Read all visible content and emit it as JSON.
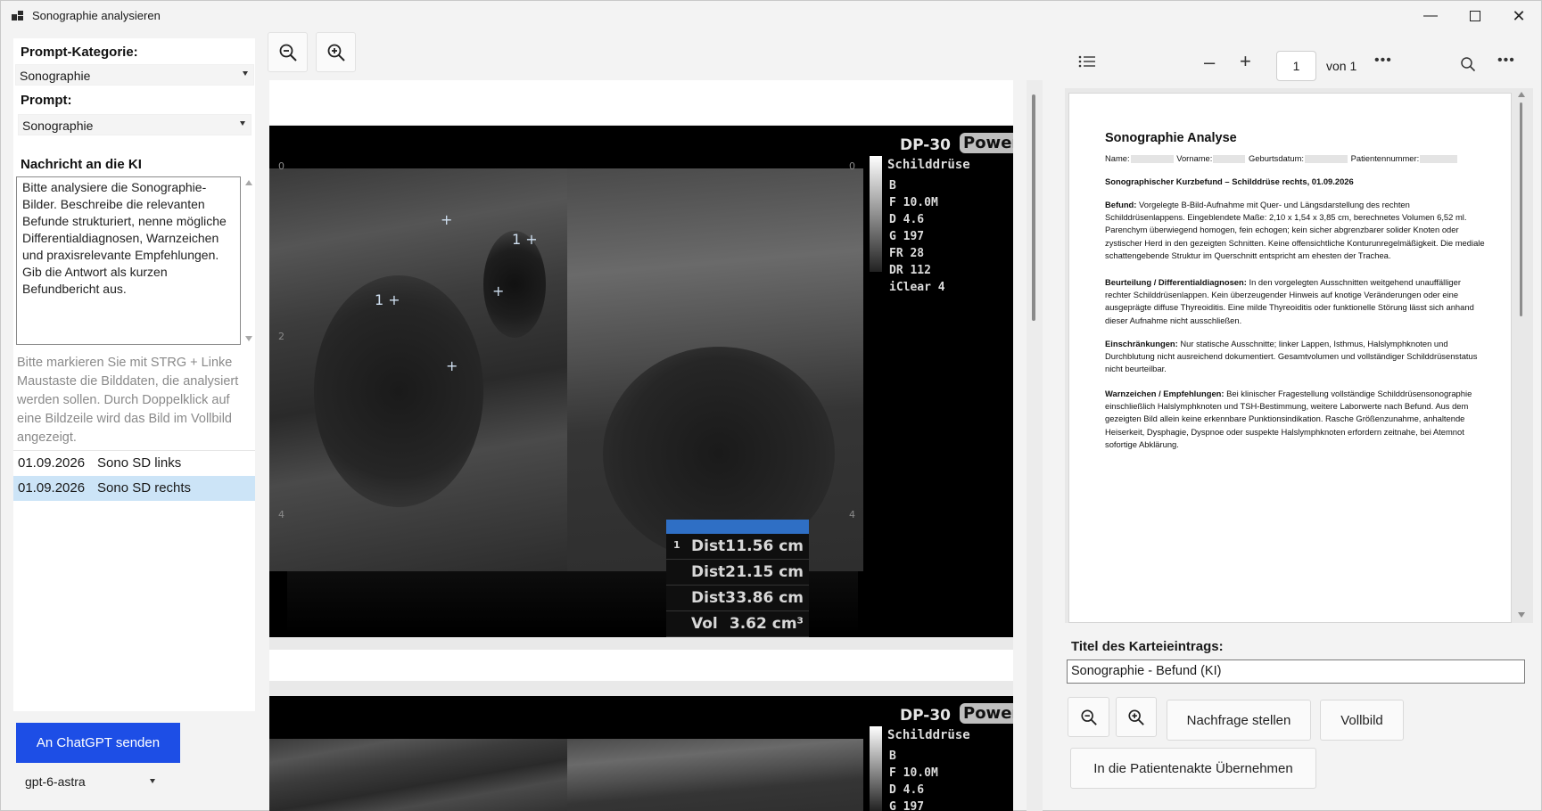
{
  "window": {
    "title": "Sonographie analysieren"
  },
  "left": {
    "prompt_category_label": "Prompt-Kategorie:",
    "prompt_category_value": "Sonographie",
    "prompt_label": "Prompt:",
    "prompt_value": "Sonographie",
    "message_label": "Nachricht an die KI",
    "message_text": "Bitte analysiere die Sonographie-Bilder. Beschreibe die relevanten Befunde strukturiert, nenne mögliche Differentialdiagnosen, Warnzeichen und praxisrelevante Empfehlungen. Gib die Antwort als kurzen Befundbericht aus.",
    "hint": "Bitte markieren Sie mit STRG + Linke Maustaste die Bilddaten, die analysiert werden sollen. Durch Doppelklick auf eine Bildzeile wird das Bild im Vollbild angezeigt.",
    "images": [
      {
        "date": "01.09.2026",
        "name": "Sono SD links",
        "selected": false
      },
      {
        "date": "01.09.2026",
        "name": "Sono SD rechts",
        "selected": true
      }
    ],
    "send_button": "An ChatGPT senden",
    "model": "gpt-6-astra"
  },
  "viewer": {
    "images": [
      {
        "brand": "DP-30",
        "mode": "Power",
        "organ": "Schilddrüse",
        "params": [
          "B",
          "F 10.0M",
          "D 4.6",
          "G 197",
          "FR 28",
          "DR 112",
          "iClear 4"
        ],
        "measurements": [
          {
            "label": "Dist1",
            "value": "1.56 cm"
          },
          {
            "label": "Dist2",
            "value": "1.15 cm"
          },
          {
            "label": "Dist3",
            "value": "3.86 cm"
          },
          {
            "label": "Vol",
            "value": "3.62 cm³"
          }
        ]
      },
      {
        "brand": "DP-30",
        "mode": "Power",
        "organ": "Schilddrüse",
        "params": [
          "B",
          "F 10.0M",
          "D 4.6",
          "G 197"
        ]
      }
    ]
  },
  "pdf": {
    "page_current": "1",
    "page_total": "von 1",
    "title": "Sonographie Analyse",
    "patient_line": {
      "name_label": "Name:",
      "vorname_label": "Vorname:",
      "geburtsdatum_label": "Geburtsdatum:",
      "patientennummer_label": "Patientennummer:"
    },
    "heading": "Sonographischer Kurzbefund – Schilddrüse rechts, 01.09.2026",
    "sections": [
      {
        "title": "Befund:",
        "text": "Vorgelegte B-Bild-Aufnahme mit Quer- und Längsdarstellung des rechten Schilddrüsenlappens. Eingeblendete Maße: 2,10 x 1,54 x 3,85 cm, berechnetes Volumen 6,52 ml. Parenchym überwiegend homogen, fein echogen; kein sicher abgrenzbarer solider Knoten oder zystischer Herd in den gezeigten Schnitten. Keine offensichtliche Konturunregelmäßigkeit. Die mediale schattengebende Struktur im Querschnitt entspricht am ehesten der Trachea."
      },
      {
        "title": "Beurteilung / Differentialdiagnosen:",
        "text": "In den vorgelegten Ausschnitten weitgehend unauffälliger rechter Schilddrüsenlappen. Kein überzeugender Hinweis auf knotige Veränderungen oder eine ausgeprägte diffuse Thyreoiditis. Eine milde Thyreoiditis oder funktionelle Störung lässt sich anhand dieser Aufnahme nicht ausschließen."
      },
      {
        "title": "Einschränkungen:",
        "text": "Nur statische Ausschnitte; linker Lappen, Isthmus, Halslymphknoten und Durchblutung nicht ausreichend dokumentiert. Gesamtvolumen und vollständiger Schilddrüsenstatus nicht beurteilbar."
      },
      {
        "title": "Warnzeichen / Empfehlungen:",
        "text": "Bei klinischer Fragestellung vollständige Schilddrüsensonographie einschließlich Halslymphknoten und TSH-Bestimmung, weitere Laborwerte nach Befund. Aus dem gezeigten Bild allein keine erkennbare Punktionsindikation. Rasche Größenzunahme, anhaltende Heiserkeit, Dysphagie, Dyspnoe oder suspekte Halslymphknoten erfordern zeitnahe, bei Atemnot sofortige Abklärung."
      }
    ]
  },
  "entry": {
    "title_label": "Titel des Karteieintrags:",
    "title_value": "Sonographie - Befund (KI)",
    "followup_button": "Nachfrage stellen",
    "fullscreen_button": "Vollbild",
    "transfer_button": "In die Patientenakte Übernehmen"
  }
}
